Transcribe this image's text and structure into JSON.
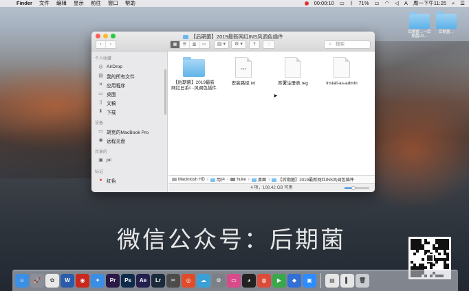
{
  "menubar": {
    "apple": "",
    "app": "Finder",
    "items": [
      "文件",
      "编辑",
      "显示",
      "前往",
      "窗口",
      "帮助"
    ],
    "record_time": "00:00:10",
    "battery": "71%",
    "clock": "周一下午11:25"
  },
  "desktop_icons": [
    {
      "label": "后期菌…一后期菌LR…"
    },
    {
      "label": "后期菌…"
    }
  ],
  "window": {
    "title": "【后期菌】2019最新网红INS风调色插件",
    "search_placeholder": "搜索",
    "view_modes": [
      "▦",
      "☰",
      "▥",
      "▭"
    ],
    "sidebar": {
      "favorites_head": "个人收藏",
      "favorites": [
        {
          "label": "AirDrop",
          "icon": "airdrop-icon"
        },
        {
          "label": "我的所有文件",
          "icon": "all-files-icon"
        },
        {
          "label": "应用程序",
          "icon": "applications-icon"
        },
        {
          "label": "桌面",
          "icon": "desktop-icon"
        },
        {
          "label": "文稿",
          "icon": "documents-icon"
        },
        {
          "label": "下载",
          "icon": "downloads-icon"
        }
      ],
      "devices_head": "设备",
      "devices": [
        {
          "label": "胡克的MacBook Pro",
          "icon": "laptop-icon"
        },
        {
          "label": "远程光盘",
          "icon": "disc-icon"
        }
      ],
      "shared_head": "共享的",
      "shared": [
        {
          "label": "pc",
          "icon": "pc-icon"
        }
      ],
      "tags_head": "标记",
      "tags": [
        {
          "label": "红色",
          "icon": "red-tag-icon",
          "color": "#e0423c"
        }
      ]
    },
    "files": [
      {
        "name": "【后期菌】2019最新网红日系I...风调色插件",
        "kind": "folder"
      },
      {
        "name": "安装路径.txt",
        "kind": "doc",
        "ext": "TXT"
      },
      {
        "name": "答署注册表.reg",
        "kind": "doc",
        "ext": ""
      },
      {
        "name": "install-as-admin",
        "kind": "doc",
        "ext": ""
      }
    ],
    "path": [
      "Macintosh HD",
      "用户",
      "huke",
      "桌面",
      "【后期菌】2019最新网红INS风调色插件"
    ],
    "status": "4 项，108.42 GB 可用",
    "icon_size_level": 0.35
  },
  "watermark": "微信公众号：后期菌",
  "dock": [
    {
      "name": "finder-icon",
      "glyph": "☺",
      "color": "#3b8fe5"
    },
    {
      "name": "launchpad-icon",
      "glyph": "🚀",
      "color": "#8a8f99"
    },
    {
      "name": "photos-icon",
      "glyph": "✿",
      "color": "#e8e8e8"
    },
    {
      "name": "word-icon",
      "glyph": "W",
      "color": "#2b5cab"
    },
    {
      "name": "netease-music-icon",
      "glyph": "◉",
      "color": "#c9281f"
    },
    {
      "name": "safari-icon",
      "glyph": "✦",
      "color": "#3a8ee6"
    },
    {
      "name": "premiere-icon",
      "glyph": "Pr",
      "color": "#2a1846"
    },
    {
      "name": "photoshop-icon",
      "glyph": "Ps",
      "color": "#0f2b4a"
    },
    {
      "name": "after-effects-icon",
      "glyph": "Ae",
      "color": "#231f4f"
    },
    {
      "name": "lightroom-icon",
      "glyph": "Lr",
      "color": "#1c2b3b"
    },
    {
      "name": "final-cut-icon",
      "glyph": "✂",
      "color": "#4b4b4b"
    },
    {
      "name": "weibo-icon",
      "glyph": "◎",
      "color": "#e04b2a"
    },
    {
      "name": "cloud-icon",
      "glyph": "☁",
      "color": "#3aa0d8"
    },
    {
      "name": "system-preferences-icon",
      "glyph": "⚙",
      "color": "#7b7f86"
    },
    {
      "name": "display-icon",
      "glyph": "▭",
      "color": "#d84a8a"
    },
    {
      "name": "qq-icon",
      "glyph": "◕",
      "color": "#222222"
    },
    {
      "name": "chrome-icon",
      "glyph": "◍",
      "color": "#dd4b39"
    },
    {
      "name": "video-icon",
      "glyph": "▶",
      "color": "#3aa84a"
    },
    {
      "name": "baidu-icon",
      "glyph": "◆",
      "color": "#3270d8"
    },
    {
      "name": "zoom-icon",
      "glyph": "▣",
      "color": "#2d8cff"
    },
    {
      "name": "finder-window-icon",
      "glyph": "▤",
      "color": "#e6e6e6"
    },
    {
      "name": "doc-window-icon",
      "glyph": "▌",
      "color": "#e6e6e6"
    },
    {
      "name": "trash-icon",
      "glyph": "🗑",
      "color": "#c9ccd1"
    }
  ]
}
